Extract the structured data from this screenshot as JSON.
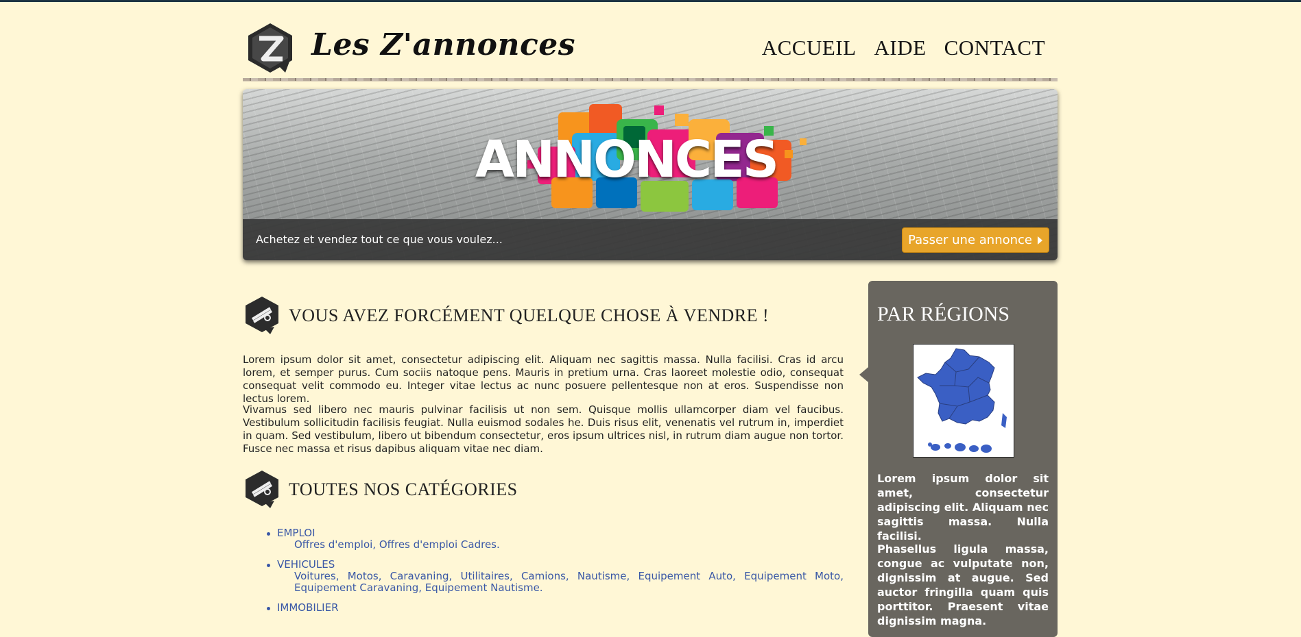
{
  "header": {
    "site_title": "Les Z'annonces",
    "nav": [
      "ACCUEIL",
      "AIDE",
      "CONTACT"
    ]
  },
  "banner": {
    "art_word": "ANNONCES",
    "caption": "Achetez et vendez tout ce que vous voulez...",
    "cta_label": "Passer une annonce"
  },
  "main": {
    "section1_title": "VOUS AVEZ FORCÉMENT QUELQUE CHOSE À VENDRE !",
    "para1": "Lorem ipsum dolor sit amet, consectetur adipiscing elit. Aliquam nec sagittis massa. Nulla facilisi. Cras id arcu lorem, et semper purus. Cum sociis natoque pens. Mauris in pretium urna. Cras laoreet molestie odio, consequat consequat velit commodo eu. Integer vitae lectus ac nunc posuere pellentesque non at eros. Suspendisse non lectus lorem.",
    "para2": "Vivamus sed libero nec mauris pulvinar facilisis ut non sem. Quisque mollis ullamcorper diam vel faucibus. Vestibulum sollicitudin facilisis feugiat. Nulla euismod sodales he. Duis risus elit, venenatis vel rutrum in, imperdiet in quam. Sed vestibulum, libero ut bibendum consectetur, eros ipsum ultrices nisl, in rutrum diam augue non tortor. Fusce nec massa et risus dapibus aliquam vitae nec diam.",
    "section2_title": "TOUTES NOS CATÉGORIES",
    "categories": [
      {
        "name": "EMPLOI",
        "sub": "Offres d'emploi, Offres d'emploi Cadres."
      },
      {
        "name": "VEHICULES",
        "sub": "Voitures, Motos, Caravaning, Utilitaires, Camions, Nautisme, Equipement Auto, Equipement Moto, Equipement Caravaning, Equipement Nautisme."
      },
      {
        "name": "IMMOBILIER",
        "sub": ""
      }
    ]
  },
  "sidebar": {
    "title": "PAR RÉGIONS",
    "text1": "Lorem ipsum dolor sit amet, consectetur adipiscing elit. Aliquam nec sagittis massa. Nulla facilisi.",
    "text2": "Phasellus ligula massa, congue ac vulputate non, dignissim at augue. Sed auctor fringilla quam quis porttitor. Praesent vitae dignissim magna."
  },
  "colors": {
    "page_bg": "#fff7d6",
    "sidebar_bg": "#69665f",
    "cta": "#e8a52a",
    "link": "#3957a6",
    "map_fill": "#3a5fc4"
  },
  "icons": [
    "logo-z-badge-icon",
    "hanger-badge-icon",
    "chevron-right-icon",
    "france-map-icon"
  ]
}
